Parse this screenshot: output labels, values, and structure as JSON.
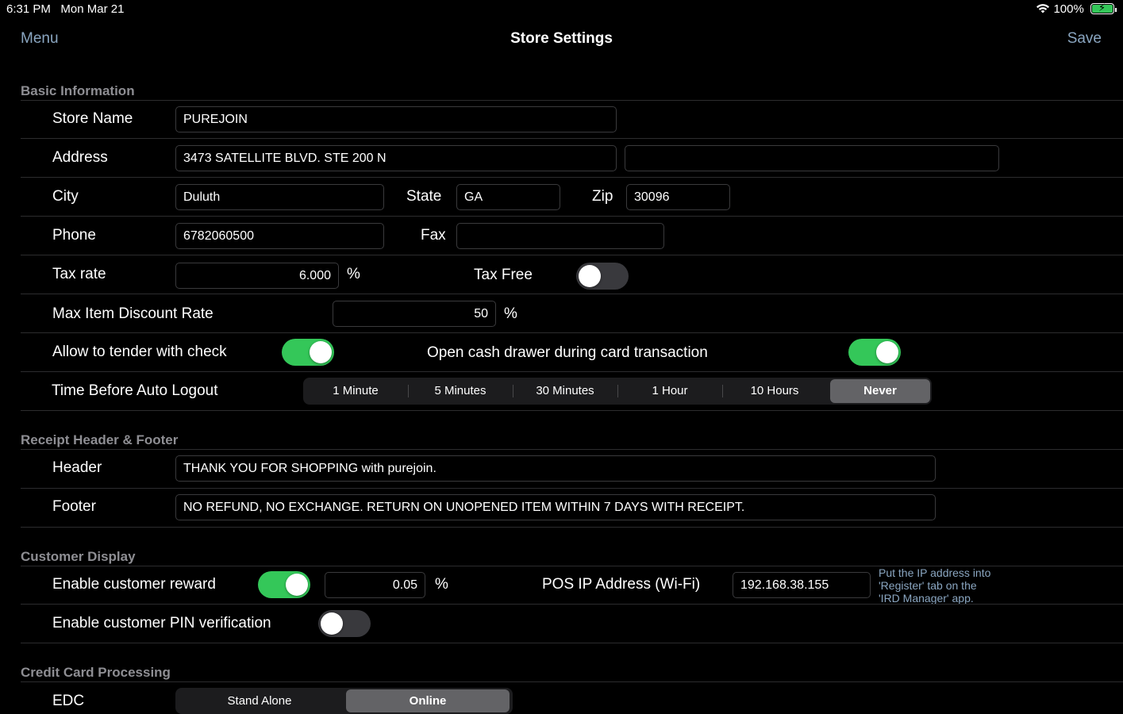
{
  "status_bar": {
    "time": "6:31 PM",
    "date": "Mon Mar 21",
    "battery": "100%"
  },
  "nav": {
    "menu": "Menu",
    "title": "Store Settings",
    "save": "Save"
  },
  "basic": {
    "section_title": "Basic Information",
    "store_name_label": "Store Name",
    "store_name": "PUREJOIN",
    "address_label": "Address",
    "address1": "3473 SATELLITE BLVD. STE 200 N",
    "address2": "",
    "city_label": "City",
    "city": "Duluth",
    "state_label": "State",
    "state": "GA",
    "zip_label": "Zip",
    "zip": "30096",
    "phone_label": "Phone",
    "phone": "6782060500",
    "fax_label": "Fax",
    "fax": "",
    "tax_rate_label": "Tax rate",
    "tax_rate": "6.000",
    "percent": "%",
    "tax_free_label": "Tax Free",
    "tax_free": false,
    "max_discount_label": "Max Item Discount Rate",
    "max_discount": "50",
    "allow_check_label": "Allow to tender with check",
    "allow_check": true,
    "open_drawer_label": "Open cash drawer during card transaction",
    "open_drawer": true,
    "auto_logout_label": "Time Before Auto Logout",
    "auto_logout_options": [
      "1 Minute",
      "5 Minutes",
      "30 Minutes",
      "1 Hour",
      "10 Hours",
      "Never"
    ],
    "auto_logout_selected": "Never"
  },
  "receipt": {
    "section_title": "Receipt Header & Footer",
    "header_label": "Header",
    "header": "THANK YOU FOR SHOPPING with purejoin.",
    "footer_label": "Footer",
    "footer": "NO REFUND, NO EXCHANGE. RETURN ON UNOPENED ITEM WITHIN 7 DAYS WITH RECEIPT."
  },
  "customer": {
    "section_title": "Customer Display",
    "reward_label": "Enable customer reward",
    "reward": true,
    "reward_rate": "0.05",
    "percent": "%",
    "pos_ip_label": "POS IP Address (Wi-Fi)",
    "pos_ip": "192.168.38.155",
    "ip_hint_1": "Put the IP address into",
    "ip_hint_2": "'Register' tab on the",
    "ip_hint_3": "'IRD Manager' app.",
    "pin_label": "Enable customer PIN verification",
    "pin": false
  },
  "credit": {
    "section_title": "Credit Card Processing",
    "edc_label": "EDC",
    "edc_options": [
      "Stand Alone",
      "Online"
    ],
    "edc_selected": "Online"
  },
  "colors": {
    "accent": "#8aa6c1",
    "toggle_on": "#34c759",
    "background": "#000000"
  }
}
